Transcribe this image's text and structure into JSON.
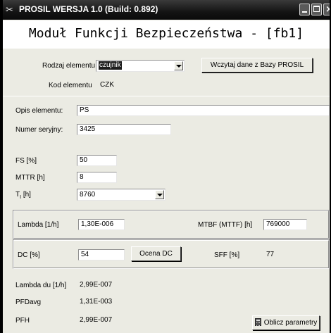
{
  "window": {
    "title": "PROSIL WERSJA 1.0 (Build: 0.892)",
    "heading": "Moduł Funkcji Bezpieczeństwa - [fb1]"
  },
  "element": {
    "type_label": "Rodzaj elementu",
    "type_value": "czujnik",
    "code_label": "Kod elementu",
    "code_value": "CZK",
    "load_button": "Wczytaj dane z Bazy PROSIL"
  },
  "description": {
    "label": "Opis elementu:",
    "value": "PS"
  },
  "serial": {
    "label": "Numer seryjny:",
    "value": "3425"
  },
  "fs": {
    "label": "FS [%]",
    "value": "50"
  },
  "mttr": {
    "label": "MTTR [h]",
    "value": "8"
  },
  "ti": {
    "label": "T",
    "subscript": "I",
    "unit": " [h]",
    "value": "8760"
  },
  "lambda": {
    "label": "Lambda [1/h]",
    "value": "1,30E-006"
  },
  "mtbf": {
    "label": "MTBF (MTTF) [h]",
    "value": "769000"
  },
  "dc": {
    "label": "DC [%]",
    "value": "54",
    "button": "Ocena DC"
  },
  "sff": {
    "label": "SFF [%]",
    "value": "77"
  },
  "lambda_du": {
    "label": "Lambda du [1/h]",
    "value": "2,99E-007"
  },
  "pfdavg": {
    "label": "PFDavg",
    "value": "1,31E-003"
  },
  "pfh": {
    "label": "PFH",
    "value": "2,99E-007"
  },
  "calc_button": "Oblicz parametry",
  "icons": [
    "app-icon",
    "minimize-icon",
    "maximize-icon",
    "close-icon",
    "dropdown-arrow-icon",
    "calculator-icon"
  ]
}
